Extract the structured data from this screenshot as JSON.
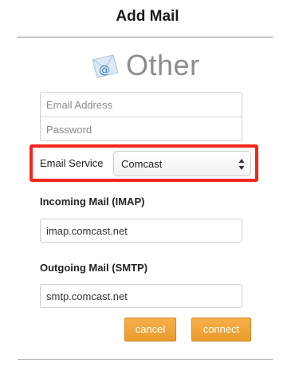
{
  "dialog": {
    "title": "Add Mail",
    "brand_label": "Other",
    "brand_icon": "at-sign-envelope-icon"
  },
  "credentials": {
    "email_placeholder": "Email Address",
    "password_placeholder": "Password"
  },
  "service": {
    "label": "Email Service",
    "selected": "Comcast",
    "highlight_color": "#f2261b"
  },
  "incoming": {
    "label": "Incoming Mail (IMAP)",
    "value": "imap.comcast.net"
  },
  "outgoing": {
    "label": "Outgoing Mail (SMTP)",
    "value": "smtp.comcast.net"
  },
  "actions": {
    "cancel_label": "cancel",
    "connect_label": "connect",
    "button_color": "#ec9a2b"
  }
}
